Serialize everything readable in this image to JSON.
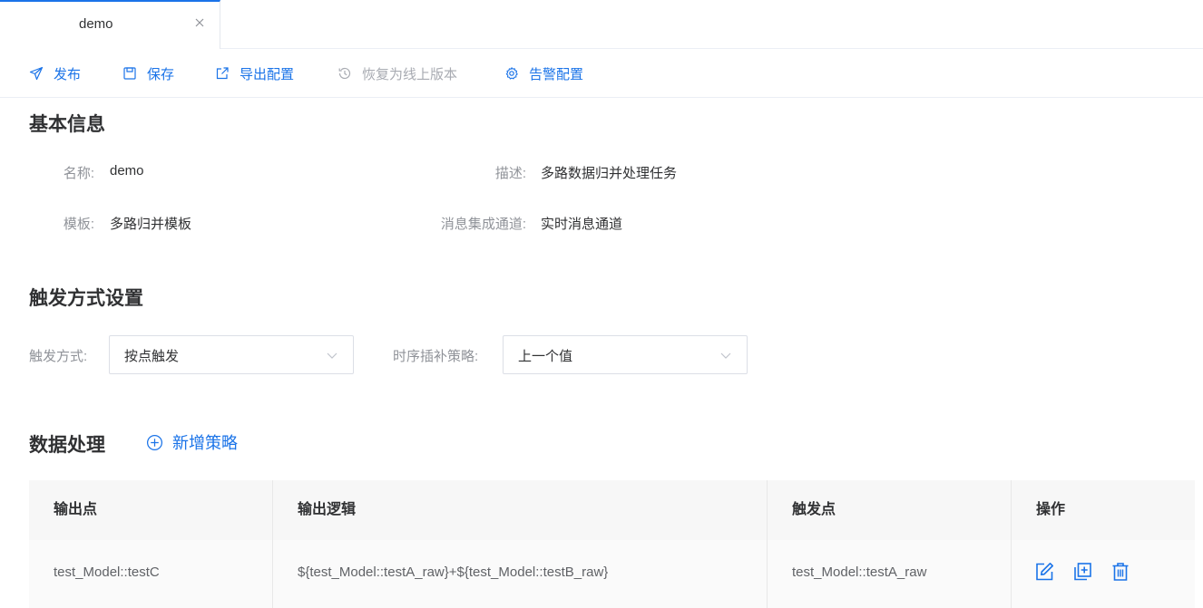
{
  "tab": {
    "label": "demo"
  },
  "toolbar": {
    "publish": "发布",
    "save": "保存",
    "export": "导出配置",
    "restore": "恢复为线上版本",
    "alarm": "告警配置"
  },
  "basic_info": {
    "title": "基本信息",
    "name_label": "名称:",
    "name_value": "demo",
    "desc_label": "描述:",
    "desc_value": "多路数据归并处理任务",
    "template_label": "模板:",
    "template_value": "多路归并模板",
    "channel_label": "消息集成通道:",
    "channel_value": "实时消息通道"
  },
  "trigger": {
    "title": "触发方式设置",
    "mode_label": "触发方式:",
    "mode_value": "按点触发",
    "fill_label": "时序插补策略:",
    "fill_value": "上一个值"
  },
  "processing": {
    "title": "数据处理",
    "add_label": "新增策略"
  },
  "table": {
    "headers": [
      "输出点",
      "输出逻辑",
      "触发点",
      "操作"
    ],
    "rows": [
      [
        "test_Model::testC",
        "${test_Model::testA_raw}+${test_Model::testB_raw}",
        "test_Model::testA_raw"
      ]
    ]
  },
  "colors": {
    "accent": "#1a73e8",
    "disabled": "#a8abb2",
    "label": "#909399"
  }
}
